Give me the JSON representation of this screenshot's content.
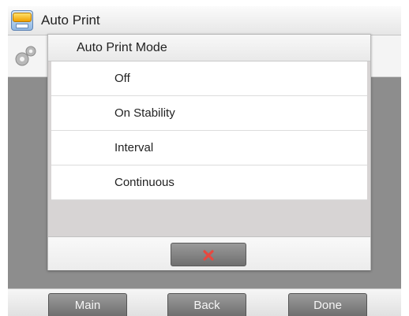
{
  "titlebar": {
    "title": "Auto Print",
    "icon": "auto-print-icon"
  },
  "settings_strip": {
    "icon": "gear-icon"
  },
  "dialog": {
    "title": "Auto Print Mode",
    "options": [
      {
        "label": "Off"
      },
      {
        "label": "On Stability"
      },
      {
        "label": "Interval"
      },
      {
        "label": "Continuous"
      }
    ],
    "cancel_icon": "close-icon"
  },
  "nav": {
    "main_label": "Main",
    "back_label": "Back",
    "done_label": "Done"
  },
  "colors": {
    "cancel_icon": "#e8483f",
    "button_gray": "#7d7d7d",
    "overlay": "#8d8d8d"
  }
}
